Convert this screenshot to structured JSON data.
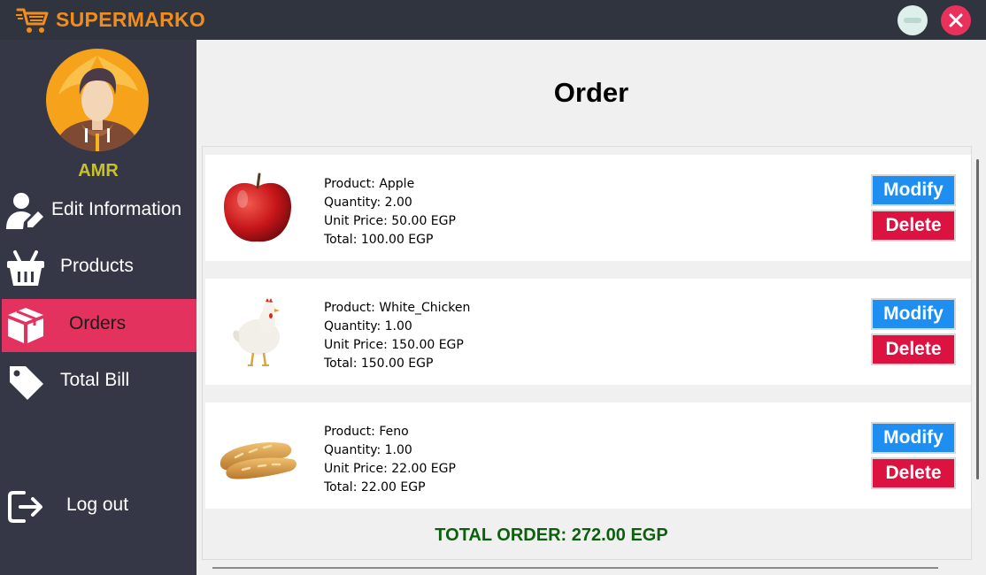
{
  "app": {
    "title": "SUPERMARKO",
    "accent_color": "#f28c1a",
    "window_controls": [
      {
        "name": "minimize",
        "icon": "minus-icon"
      },
      {
        "name": "close",
        "icon": "close-icon"
      }
    ]
  },
  "sidebar": {
    "user_name": "AMR",
    "avatar_icon": "user-avatar-icon",
    "items": [
      {
        "label": "Edit Information",
        "icon": "user-edit-icon",
        "active": false
      },
      {
        "label": "Products",
        "icon": "basket-icon",
        "active": false
      },
      {
        "label": "Orders",
        "icon": "box-icon",
        "active": true
      },
      {
        "label": "Total Bill",
        "icon": "tag-icon",
        "active": false
      }
    ],
    "logout": {
      "label": "Log out",
      "icon": "logout-icon"
    },
    "active_color": "#e3325e"
  },
  "main": {
    "title": "Order",
    "orders": [
      {
        "product": "Product: Apple",
        "quantity": "Quantity: 2.00",
        "unit_price": "Unit Price: 50.00 EGP",
        "total": "Total: 100.00 EGP",
        "image_icon": "apple-image"
      },
      {
        "product": "Product: White_Chicken",
        "quantity": "Quantity: 1.00",
        "unit_price": "Unit Price: 150.00 EGP",
        "total": "Total: 150.00 EGP",
        "image_icon": "chicken-image"
      },
      {
        "product": "Product: Feno",
        "quantity": "Quantity: 1.00",
        "unit_price": "Unit Price: 22.00 EGP",
        "total": "Total: 22.00 EGP",
        "image_icon": "bread-image"
      }
    ],
    "modify_label": "Modify",
    "delete_label": "Delete",
    "modify_color": "#1e8ff0",
    "delete_color": "#dc1341",
    "total_order": "TOTAL ORDER: 272.00 EGP",
    "total_color": "#0c5f0c"
  }
}
